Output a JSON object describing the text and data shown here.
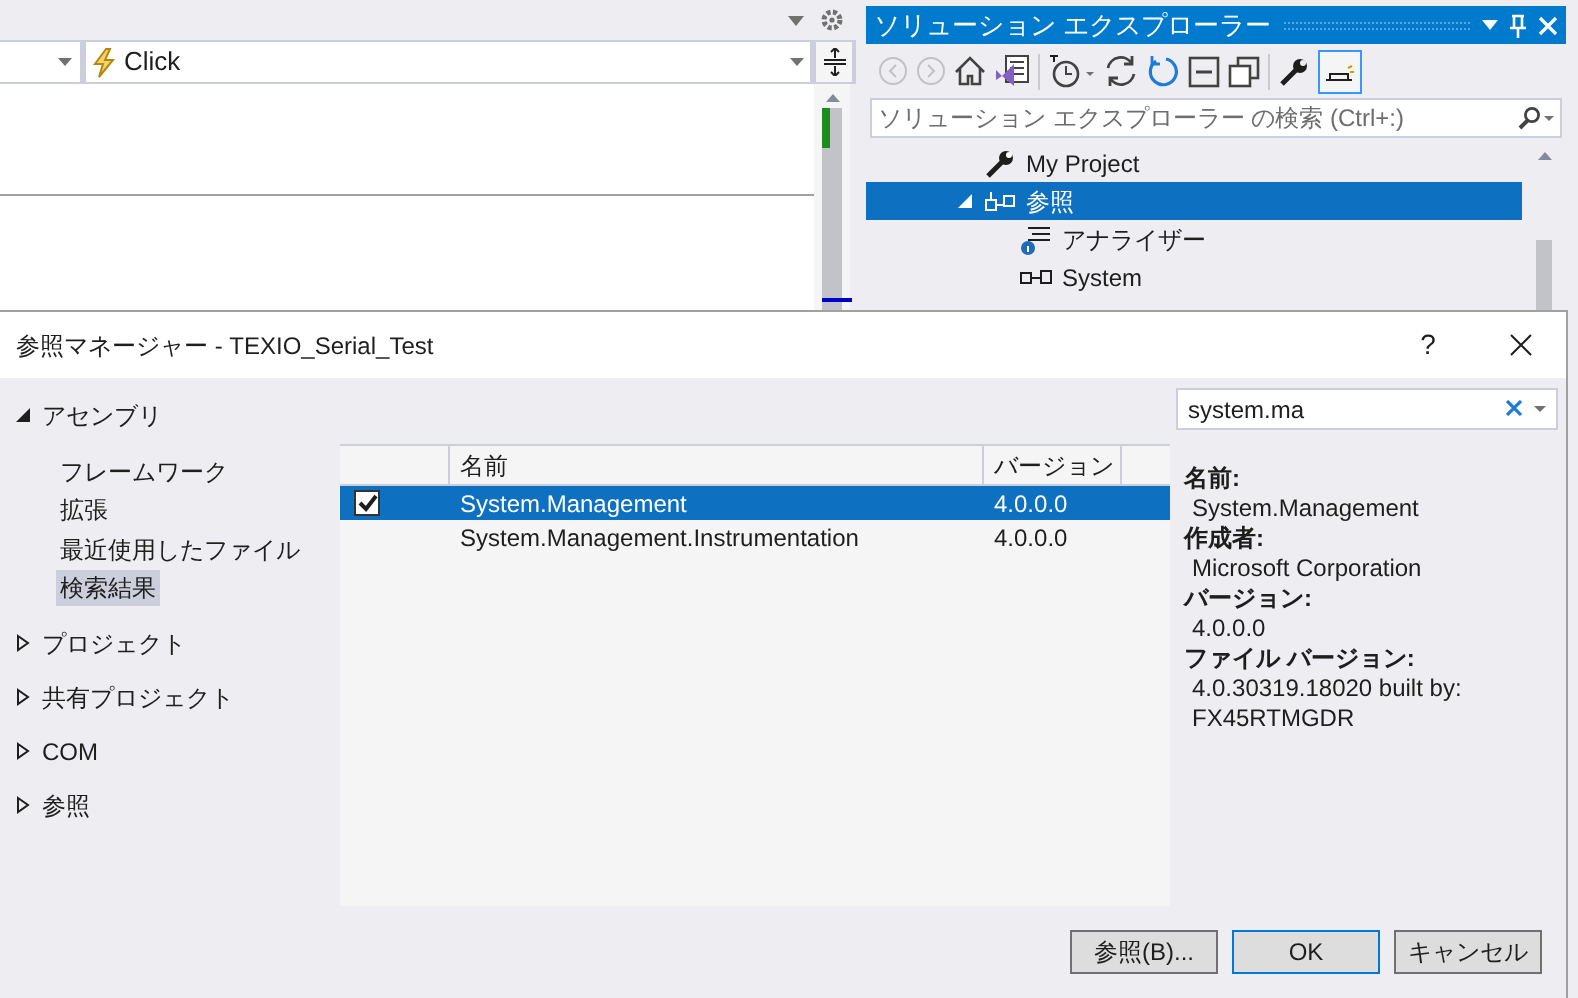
{
  "editor": {
    "event_combo": {
      "value": "Click"
    }
  },
  "solution_explorer": {
    "title": "ソリューション エクスプローラー",
    "search": {
      "placeholder": "ソリューション エクスプローラー の検索 (Ctrl+:)"
    },
    "tree": [
      {
        "label": "My Project",
        "kind": "settings",
        "selected": false
      },
      {
        "label": "参照",
        "kind": "references",
        "selected": true,
        "expanded": true,
        "children": [
          {
            "label": "アナライザー",
            "kind": "analyzer",
            "selected": false
          },
          {
            "label": "System",
            "kind": "reference",
            "selected": false
          }
        ]
      }
    ]
  },
  "dialog": {
    "title": "参照マネージャー - TEXIO_Serial_Test",
    "help": "?",
    "nav": [
      {
        "label": "アセンブリ",
        "expanded": true,
        "children": [
          {
            "label": "フレームワーク",
            "selected": false
          },
          {
            "label": "拡張",
            "selected": false
          },
          {
            "label": "最近使用したファイル",
            "selected": false
          },
          {
            "label": "検索結果",
            "selected": true
          }
        ]
      },
      {
        "label": "プロジェクト",
        "expanded": false
      },
      {
        "label": "共有プロジェクト",
        "expanded": false
      },
      {
        "label": "COM",
        "expanded": false
      },
      {
        "label": "参照",
        "expanded": false
      }
    ],
    "table": {
      "columns": [
        "名前",
        "バージョン"
      ],
      "rows": [
        {
          "checked": true,
          "selected": true,
          "cells": [
            "System.Management",
            "4.0.0.0"
          ]
        },
        {
          "checked": false,
          "selected": false,
          "cells": [
            "System.Management.Instrumentation",
            "4.0.0.0"
          ]
        }
      ]
    },
    "search": {
      "value": "system.ma"
    },
    "details": [
      {
        "label": "名前:",
        "value": "System.Management"
      },
      {
        "label": "作成者:",
        "value": "Microsoft Corporation"
      },
      {
        "label": "バージョン:",
        "value": "4.0.0.0"
      },
      {
        "label": "ファイル バージョン:",
        "value": "4.0.30319.18020 built by: FX45RTMGDR"
      }
    ],
    "buttons": [
      {
        "label": "参照(B)...",
        "default": false
      },
      {
        "label": "OK",
        "default": true
      },
      {
        "label": "キャンセル",
        "default": false
      }
    ]
  }
}
